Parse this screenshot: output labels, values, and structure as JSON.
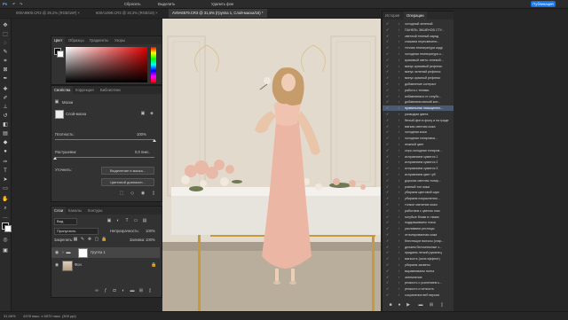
{
  "topbar": {
    "left_items": [
      "Ps",
      "↶",
      "↷"
    ],
    "tool_opts": "Сбросить",
    "auto_select": "Выделить",
    "remove_label": "Удалить фон",
    "publish_label": "Публикация"
  },
  "doc_tabs": [
    {
      "label": "000A9900.CR3 @ 29,2% (RGB/16#) ×"
    },
    {
      "label": "600A1099.CR3 @ 33,3% (RGB/16) ×"
    },
    {
      "label": "AV9A6579.CR3 @ 31,6% (Группа 1, Слой-маска/16) *"
    }
  ],
  "color_panel": {
    "tabs": [
      "Цвет",
      "Образцы",
      "Градиенты",
      "Узоры"
    ]
  },
  "properties_panel": {
    "tabs": [
      "Свойства",
      "Коррекция",
      "Библиотеки"
    ],
    "mask_header": "Маски",
    "layer_mask": "Слой-маска",
    "density_label": "Плотность:",
    "density_value": "100%",
    "feather_label": "Растушевка:",
    "feather_value": "0,0 пикс.",
    "refine_label": "Уточнить:",
    "select_mask_btn": "Выделение и маска...",
    "color_range_btn": "Цветовой диапазон..."
  },
  "layers_panel": {
    "tabs": [
      "Слои",
      "Каналы",
      "Контуры"
    ],
    "filter": "Вид",
    "blend_mode": "Пропустить",
    "opacity_label": "Непрозрачность:",
    "opacity_value": "100%",
    "lock_label": "Закрепить:",
    "fill_label": "Заливка:",
    "fill_value": "100%",
    "layers": [
      {
        "name": "Группа 1"
      },
      {
        "name": "Фон"
      }
    ]
  },
  "history_panel": {
    "tabs": [
      "История",
      "Операции"
    ],
    "items": [
      "холодный зеленый",
      "ПАНЕЛЬ ЭКШЕНОВ СТУ...",
      "светлый темный заряд",
      "спасаем пересвеченн...",
      "теплая температура кадр",
      "холодная температура к...",
      "красивый свето-теневой...",
      "минус красивый рефлекс",
      "минус зеленый рефлекс",
      "минус красный рефлекс",
      "добавление контраст",
      "работа с тенями",
      "избавляемся от голубо...",
      "добавляем мягкий кон...",
      "правильная насыщенно...",
      "разводим цвета",
      "белый фон в фону и на граде",
      "мягкая светлая кожа",
      "холодная кожа",
      "холодная тонировка...",
      "нежный цвет",
      "серо-холодная тониров...",
      "исправляем сумятся 1",
      "исправляем сумятся 2",
      "исправляем сумятся 3",
      "исправляем цвет губ",
      "дорогая светлая тонир...",
      "ровный тон кожи",
      "убираем цветовой шум",
      "убираем покраснения...",
      "тонкое свечение кожи",
      "работаем с цветом глаз",
      "голубые блики в глазах",
      "подкрашиваем глаза",
      "усиливаем ресницы",
      "отполированная кожа",
      "блестящие волосы (стар...",
      "делаем белоснежные з...",
      "придаем легкий румянец",
      "мягкость (зона эффект)",
      "убираем засветы",
      "выравниваем пятна",
      "затемнение",
      "резкость с усилением к...",
      "резкость и четкость",
      "сохранение веб версии"
    ],
    "selected_index": 14
  },
  "status": {
    "zoom": "31,56%",
    "size": "4378 пикс. x 6570 пикс. (300 ppi)"
  }
}
